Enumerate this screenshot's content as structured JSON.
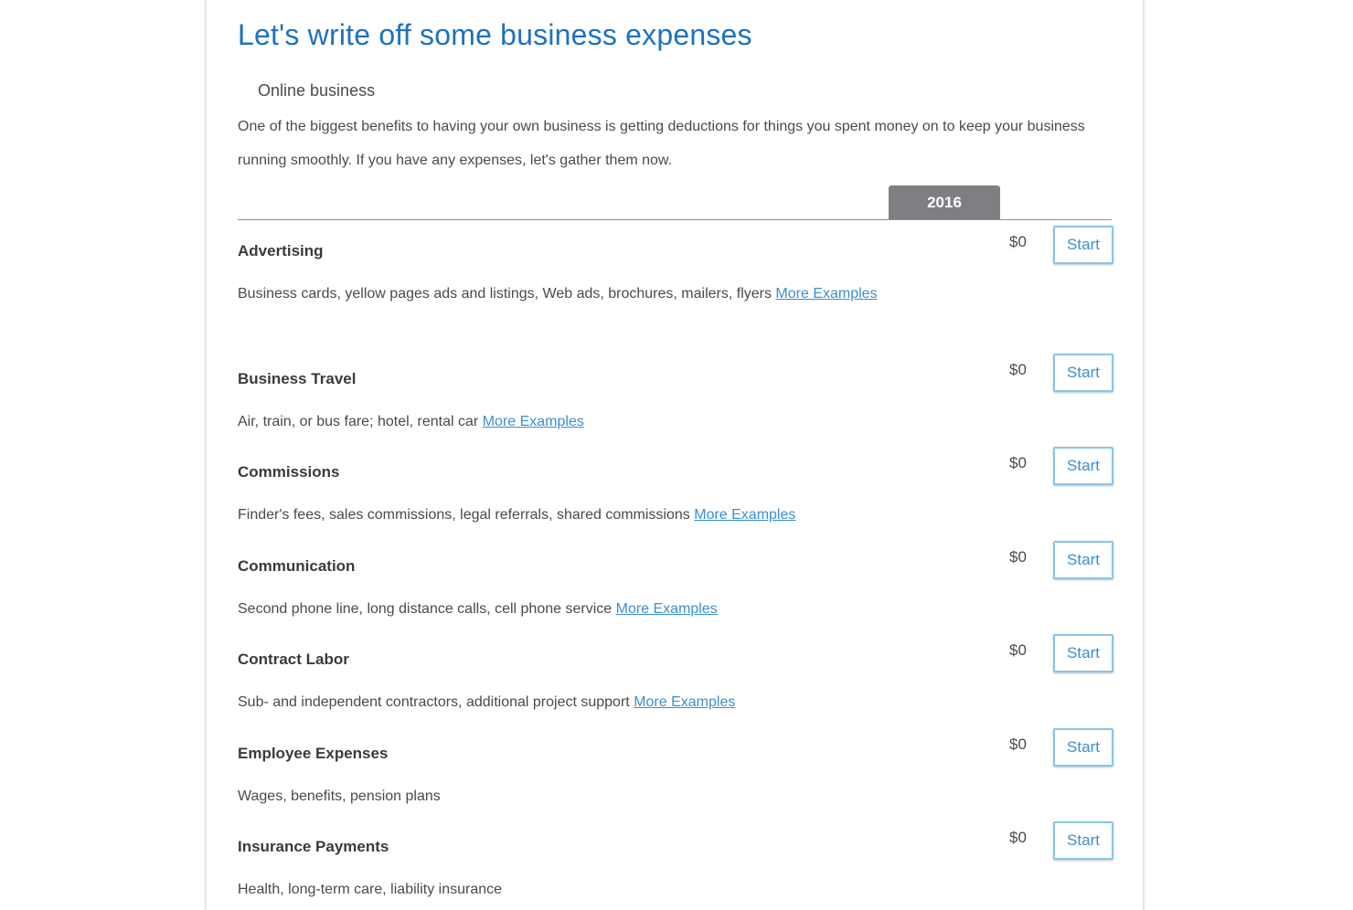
{
  "header": {
    "title": "Let's write off some business expenses",
    "subtitle": "Online business",
    "intro": "One of the biggest benefits to having your own business is getting deductions for things you spent money on to keep your business running smoothly. If you have any expenses, let's gather them now."
  },
  "year_tab": "2016",
  "start_label": "Start",
  "more_label": "More Examples",
  "rows": [
    {
      "name": "Advertising",
      "amount": "$0",
      "desc": "Business cards, yellow pages ads and listings, Web ads, brochures, mailers, flyers"
    },
    {
      "name": "Business Travel",
      "amount": "$0",
      "desc": "Air, train, or bus fare; hotel, rental car"
    },
    {
      "name": "Commissions",
      "amount": "$0",
      "desc": "Finder's fees, sales commissions, legal referrals, shared commissions"
    },
    {
      "name": "Communication",
      "amount": "$0",
      "desc": "Second phone line, long distance calls, cell phone service"
    },
    {
      "name": "Contract Labor",
      "amount": "$0",
      "desc": "Sub- and independent contractors, additional project support"
    },
    {
      "name": "Employee Expenses",
      "amount": "$0",
      "desc": "Wages, benefits, pension plans"
    },
    {
      "name": "Insurance Payments",
      "amount": "$0",
      "desc": "Health, long-term care, liability insurance"
    }
  ],
  "colors": {
    "title": "#1e72bd",
    "link": "#3a8fd0",
    "tab_bg": "#7e7f83",
    "button_border": "#89c5e8"
  }
}
